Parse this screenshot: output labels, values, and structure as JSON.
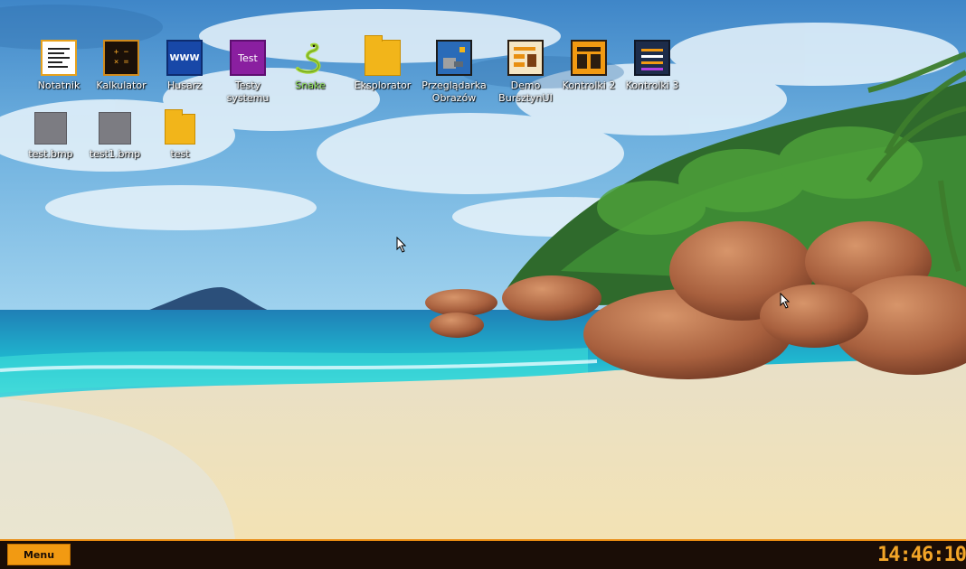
{
  "desktop": {
    "icons": [
      {
        "label": "Notatnik",
        "icon": "notepad-icon"
      },
      {
        "label": "Kalkulator",
        "icon": "calculator-icon"
      },
      {
        "label": "Husarz",
        "icon": "browser-www-icon",
        "glyph": "WWW"
      },
      {
        "label": "Testy\nsystemu",
        "icon": "test-icon",
        "glyph": "Test"
      },
      {
        "label": "Snake",
        "icon": "snake-icon"
      },
      {
        "label": "Eksplorator",
        "icon": "folder-icon"
      },
      {
        "label": "Przeglądarka\nObrazów",
        "icon": "image-viewer-icon"
      },
      {
        "label": "Demo\nBursztynUI",
        "icon": "demo-window-icon"
      },
      {
        "label": "Kontrolki 2",
        "icon": "controls-layout-icon"
      },
      {
        "label": "Kontrolki 3",
        "icon": "sliders-icon"
      },
      {
        "label": "test.bmp",
        "icon": "bmp-file-icon"
      },
      {
        "label": "test1.bmp",
        "icon": "bmp-file-icon"
      },
      {
        "label": "test",
        "icon": "folder-icon"
      }
    ],
    "kalkulator_glyph": "+ −\n× =",
    "wallpaper": "tropical-beach"
  },
  "taskbar": {
    "menu_label": "Menu",
    "clock": "14:46:10",
    "accent": "#f29a12",
    "background": "#1a0d06"
  }
}
